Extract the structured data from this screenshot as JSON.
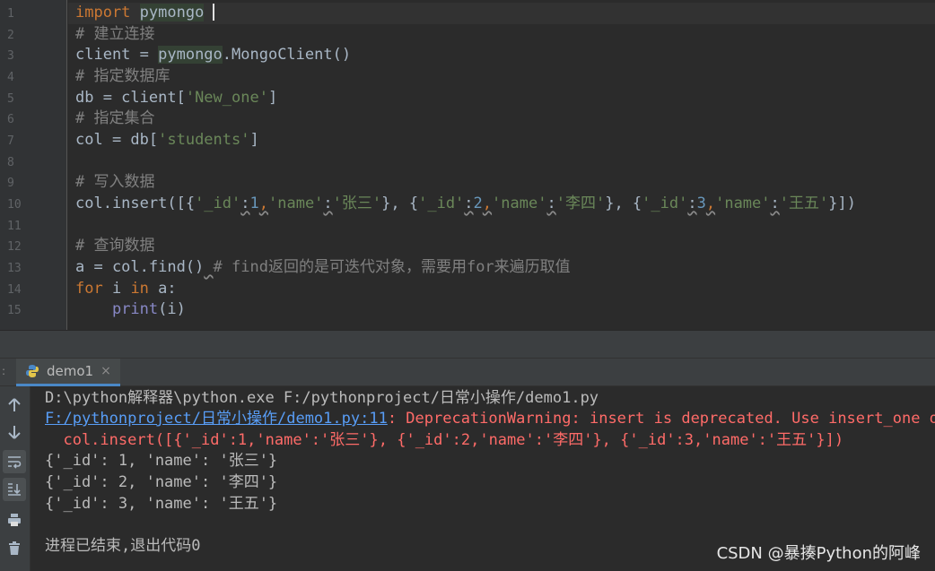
{
  "editor": {
    "line_numbers": [
      "1",
      "2",
      "3",
      "4",
      "5",
      "6",
      "7",
      "8",
      "9",
      "10",
      "11",
      "12",
      "13",
      "14",
      "15"
    ],
    "lines": {
      "l1": {
        "kw": "import",
        "rest": "pymongo"
      },
      "l2": "# 建立连接",
      "l3": {
        "a": "client = ",
        "b": "pymongo",
        ".c": ".MongoClient()"
      },
      "l4": "# 指定数据库",
      "l5": {
        "a": "db = client[",
        "s": "'New_one'",
        "b": "]"
      },
      "l6": "# 指定集合",
      "l7": {
        "a": "col = db[",
        "s": "'students'",
        "b": "]"
      },
      "l9": "# 写入数据",
      "l10": {
        "a": "col.insert([{",
        "s1": "'_id'",
        "c1": ":",
        "n1": "1",
        ",1": ",",
        "s2": "'name'",
        "c2": ":",
        "s3": "'张三'",
        "m1": "}, {",
        "s4": "'_id'",
        "c3": ":",
        "n2": "2",
        ",2": ",",
        "s5": "'name'",
        "c4": ":",
        "s6": "'李四'",
        "m2": "}, {",
        "s7": "'_id'",
        "c5": ":",
        "n3": "3",
        ",3": ",",
        "s8": "'name'",
        "c6": ":",
        "s9": "'王五'",
        "e": "}])"
      },
      "l12": "# 查询数据",
      "l13": {
        "a": "a = col.find()",
        "sp": " ",
        "cm": "# find返回的是可迭代对象，需要用for来遍历取值"
      },
      "l14": {
        "kw1": "for",
        "a": " i ",
        "kw2": "in",
        "b": " a:"
      },
      "l15": {
        "ind": "    ",
        "fn": "print",
        "b": "(i)"
      }
    }
  },
  "run_panel": {
    "tab_label": "demo1",
    "tab_close": "×",
    "toolbar_icons": [
      "up-arrow-icon",
      "down-arrow-icon",
      "soft-wrap-icon",
      "scroll-to-end-icon",
      "print-icon",
      "trash-icon"
    ]
  },
  "console": {
    "l1": "D:\\python解释器\\python.exe F:/pythonproject/日常小操作/demo1.py",
    "l2_link": "F:/pythonproject/日常小操作/demo1.py:11",
    "l2_rest": ": DeprecationWarning: insert is deprecated. Use insert_one or insert_many instead.",
    "l3": "  col.insert([{'_id':1,'name':'张三'}, {'_id':2,'name':'李四'}, {'_id':3,'name':'王五'}])",
    "l4": "{'_id': 1, 'name': '张三'}",
    "l5": "{'_id': 2, 'name': '李四'}",
    "l6": "{'_id': 3, 'name': '王五'}",
    "l8": "进程已结束,退出代码0"
  },
  "watermark": "CSDN @暴揍Python的阿峰",
  "colors": {
    "keyword": "#cc7832",
    "string": "#6a8759",
    "number": "#6897bb",
    "comment": "#808080",
    "error": "#ff6b68",
    "link": "#589df6"
  }
}
